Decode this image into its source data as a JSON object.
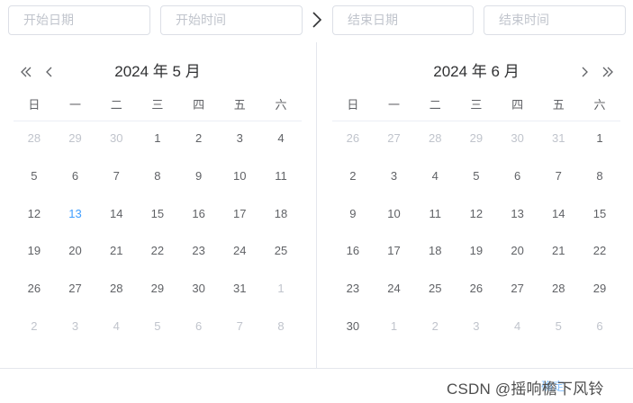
{
  "inputs": {
    "start_date": "开始日期",
    "start_time": "开始时间",
    "end_date": "结束日期",
    "end_time": "结束时间"
  },
  "separator_icon": "chevron-right-icon",
  "left_calendar": {
    "title": "2024 年 5 月",
    "weekdays": [
      "日",
      "一",
      "二",
      "三",
      "四",
      "五",
      "六"
    ],
    "weeks": [
      [
        {
          "d": "28",
          "off": true
        },
        {
          "d": "29",
          "off": true
        },
        {
          "d": "30",
          "off": true
        },
        {
          "d": "1"
        },
        {
          "d": "2"
        },
        {
          "d": "3"
        },
        {
          "d": "4"
        }
      ],
      [
        {
          "d": "5"
        },
        {
          "d": "6"
        },
        {
          "d": "7"
        },
        {
          "d": "8"
        },
        {
          "d": "9"
        },
        {
          "d": "10"
        },
        {
          "d": "11"
        }
      ],
      [
        {
          "d": "12"
        },
        {
          "d": "13",
          "today": true
        },
        {
          "d": "14"
        },
        {
          "d": "15"
        },
        {
          "d": "16"
        },
        {
          "d": "17"
        },
        {
          "d": "18"
        }
      ],
      [
        {
          "d": "19"
        },
        {
          "d": "20"
        },
        {
          "d": "21"
        },
        {
          "d": "22"
        },
        {
          "d": "23"
        },
        {
          "d": "24"
        },
        {
          "d": "25"
        }
      ],
      [
        {
          "d": "26"
        },
        {
          "d": "27"
        },
        {
          "d": "28"
        },
        {
          "d": "29"
        },
        {
          "d": "30"
        },
        {
          "d": "31"
        },
        {
          "d": "1",
          "off": true
        }
      ],
      [
        {
          "d": "2",
          "off": true
        },
        {
          "d": "3",
          "off": true
        },
        {
          "d": "4",
          "off": true
        },
        {
          "d": "5",
          "off": true
        },
        {
          "d": "6",
          "off": true
        },
        {
          "d": "7",
          "off": true
        },
        {
          "d": "8",
          "off": true
        }
      ]
    ]
  },
  "right_calendar": {
    "title": "2024 年 6 月",
    "weekdays": [
      "日",
      "一",
      "二",
      "三",
      "四",
      "五",
      "六"
    ],
    "weeks": [
      [
        {
          "d": "26",
          "off": true
        },
        {
          "d": "27",
          "off": true
        },
        {
          "d": "28",
          "off": true
        },
        {
          "d": "29",
          "off": true
        },
        {
          "d": "30",
          "off": true
        },
        {
          "d": "31",
          "off": true
        },
        {
          "d": "1"
        }
      ],
      [
        {
          "d": "2"
        },
        {
          "d": "3"
        },
        {
          "d": "4"
        },
        {
          "d": "5"
        },
        {
          "d": "6"
        },
        {
          "d": "7"
        },
        {
          "d": "8"
        }
      ],
      [
        {
          "d": "9"
        },
        {
          "d": "10"
        },
        {
          "d": "11"
        },
        {
          "d": "12"
        },
        {
          "d": "13"
        },
        {
          "d": "14"
        },
        {
          "d": "15"
        }
      ],
      [
        {
          "d": "16"
        },
        {
          "d": "17"
        },
        {
          "d": "18"
        },
        {
          "d": "19"
        },
        {
          "d": "20"
        },
        {
          "d": "21"
        },
        {
          "d": "22"
        }
      ],
      [
        {
          "d": "23"
        },
        {
          "d": "24"
        },
        {
          "d": "25"
        },
        {
          "d": "26"
        },
        {
          "d": "27"
        },
        {
          "d": "28"
        },
        {
          "d": "29"
        }
      ],
      [
        {
          "d": "30"
        },
        {
          "d": "1",
          "off": true
        },
        {
          "d": "2",
          "off": true
        },
        {
          "d": "3",
          "off": true
        },
        {
          "d": "4",
          "off": true
        },
        {
          "d": "5",
          "off": true
        },
        {
          "d": "6",
          "off": true
        }
      ]
    ]
  },
  "footer": {
    "confirm_label": "确定",
    "watermark": "CSDN @摇响檐下风铃"
  },
  "colors": {
    "today": "#409eff",
    "off_day": "#c0c4cc",
    "normal_day": "#606266",
    "border": "#dcdfe6"
  }
}
